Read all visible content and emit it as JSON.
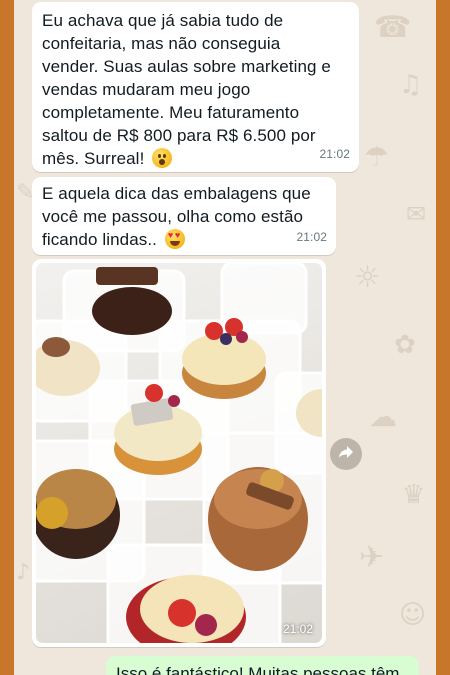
{
  "messages": [
    {
      "direction": "incoming",
      "text": "Eu achava que já sabia tudo de\nconfeitaria, mas não conseguia\nvender. Suas aulas sobre marketing e\nvendas mudaram meu jogo\ncompletamente. Meu faturamento\nsaltou de R$ 800 para R$ 6.500 por\nmês. Surreal!",
      "emoji": "astonished-face-emoji",
      "time": "21:02"
    },
    {
      "direction": "incoming",
      "text": "E aquela dica das embalagens que\nvocê me passou, olha como estão\nficando lindas..",
      "emoji": "heart-eyes-emoji",
      "time": "21:02"
    },
    {
      "direction": "incoming",
      "type": "photo",
      "photo_subject": "cakes-in-clear-boxes",
      "time": "21:02"
    },
    {
      "direction": "outgoing",
      "text": "Isso é fantástico! Muitas pessoas têm"
    }
  ],
  "icons": {
    "forward": "forward-arrow-icon"
  },
  "colors": {
    "frame": "#c8772a",
    "wallpaper": "#efe7dc",
    "incoming_bubble": "#ffffff",
    "outgoing_bubble": "#d9fdd3",
    "timestamp": "#667781"
  }
}
